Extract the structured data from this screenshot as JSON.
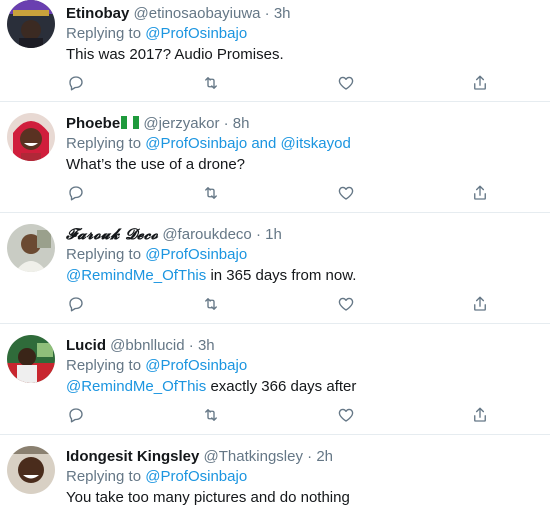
{
  "reply_prefix": "Replying to",
  "tweets": [
    {
      "name": "Etinobay",
      "handle": "@etinosaobayiuwa",
      "time": "3h",
      "replying_to": [
        "@ProfOsinbajo"
      ],
      "text_mention": "",
      "text": "This was 2017? Audio Promises."
    },
    {
      "name": "Phoebe",
      "handle": "@jerzyakor",
      "time": "8h",
      "replying_to": [
        "@ProfOsinbajo",
        "and",
        "@itskayod"
      ],
      "text_mention": "",
      "text": "What’s the use of a drone?"
    },
    {
      "name": "𝓕𝓪𝓻𝓸𝓾𝓴 𝓓𝓮𝓬𝓸",
      "handle": "@faroukdeco",
      "time": "1h",
      "replying_to": [
        "@ProfOsinbajo"
      ],
      "text_mention": "@RemindMe_OfThis",
      "text": " in 365 days from now."
    },
    {
      "name": "Lucid",
      "handle": "@bbnllucid",
      "time": "3h",
      "replying_to": [
        "@ProfOsinbajo"
      ],
      "text_mention": "@RemindMe_OfThis",
      "text": " exactly 366 days after"
    },
    {
      "name": "Idongesit Kingsley",
      "handle": "@Thatkingsley",
      "time": "2h",
      "replying_to": [
        "@ProfOsinbajo"
      ],
      "text_mention": "",
      "text": "You take too many pictures and do nothing"
    }
  ],
  "separator": "·",
  "icons": [
    "reply-icon",
    "retweet-icon",
    "like-icon",
    "share-icon"
  ],
  "colors": {
    "link": "#1b95e0",
    "muted": "#657786",
    "divider": "#e6ecf0"
  }
}
